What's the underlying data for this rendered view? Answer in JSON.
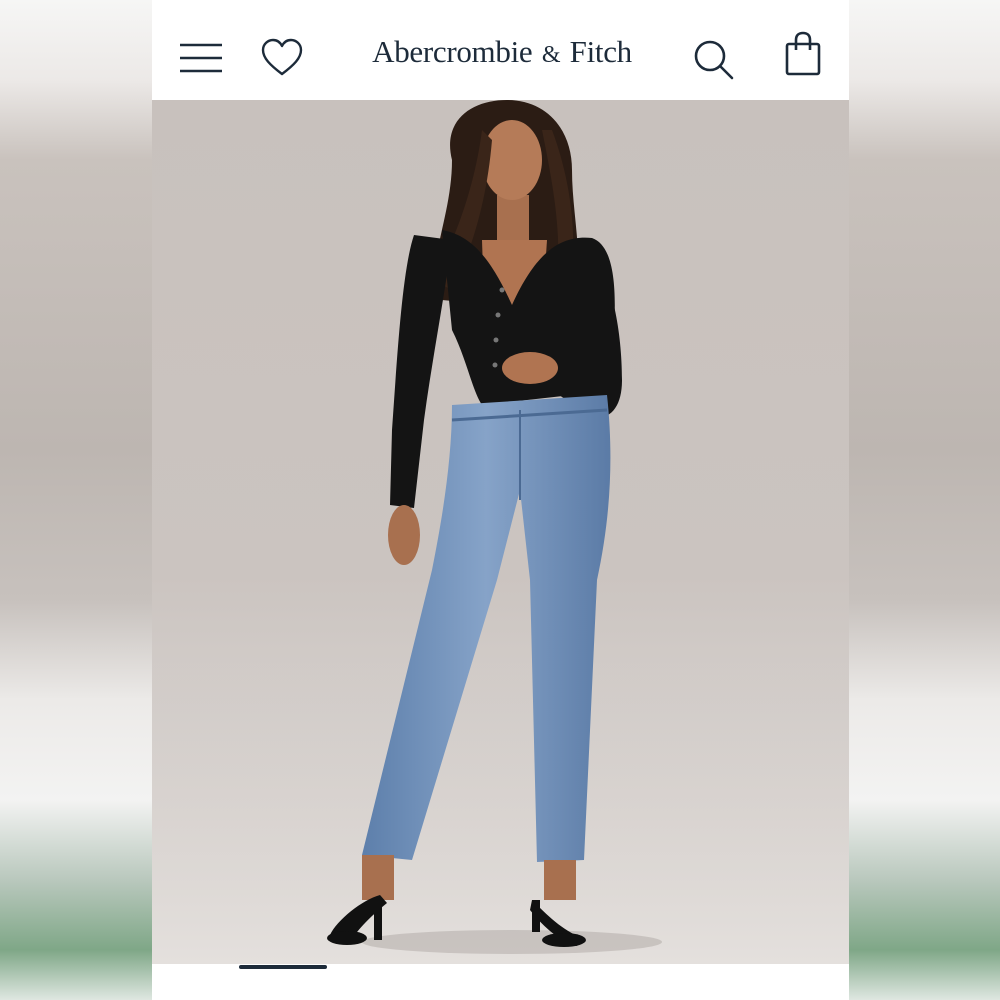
{
  "header": {
    "brand_name": "Abercrombie",
    "brand_amp": "&",
    "brand_name2": "Fitch",
    "icons": {
      "menu": "menu-icon",
      "wishlist": "heart-icon",
      "search": "search-icon",
      "bag": "shopping-bag-icon"
    }
  },
  "hero": {
    "image": "model-wearing-black-cardigan-and-light-wash-jeans"
  },
  "carousel": {
    "active_index": 1,
    "count": 1
  },
  "colors": {
    "brand": "#1d2b3a",
    "backdrop": "#c8c1bd",
    "denim": "#6d8eb8",
    "top": "#141414"
  }
}
